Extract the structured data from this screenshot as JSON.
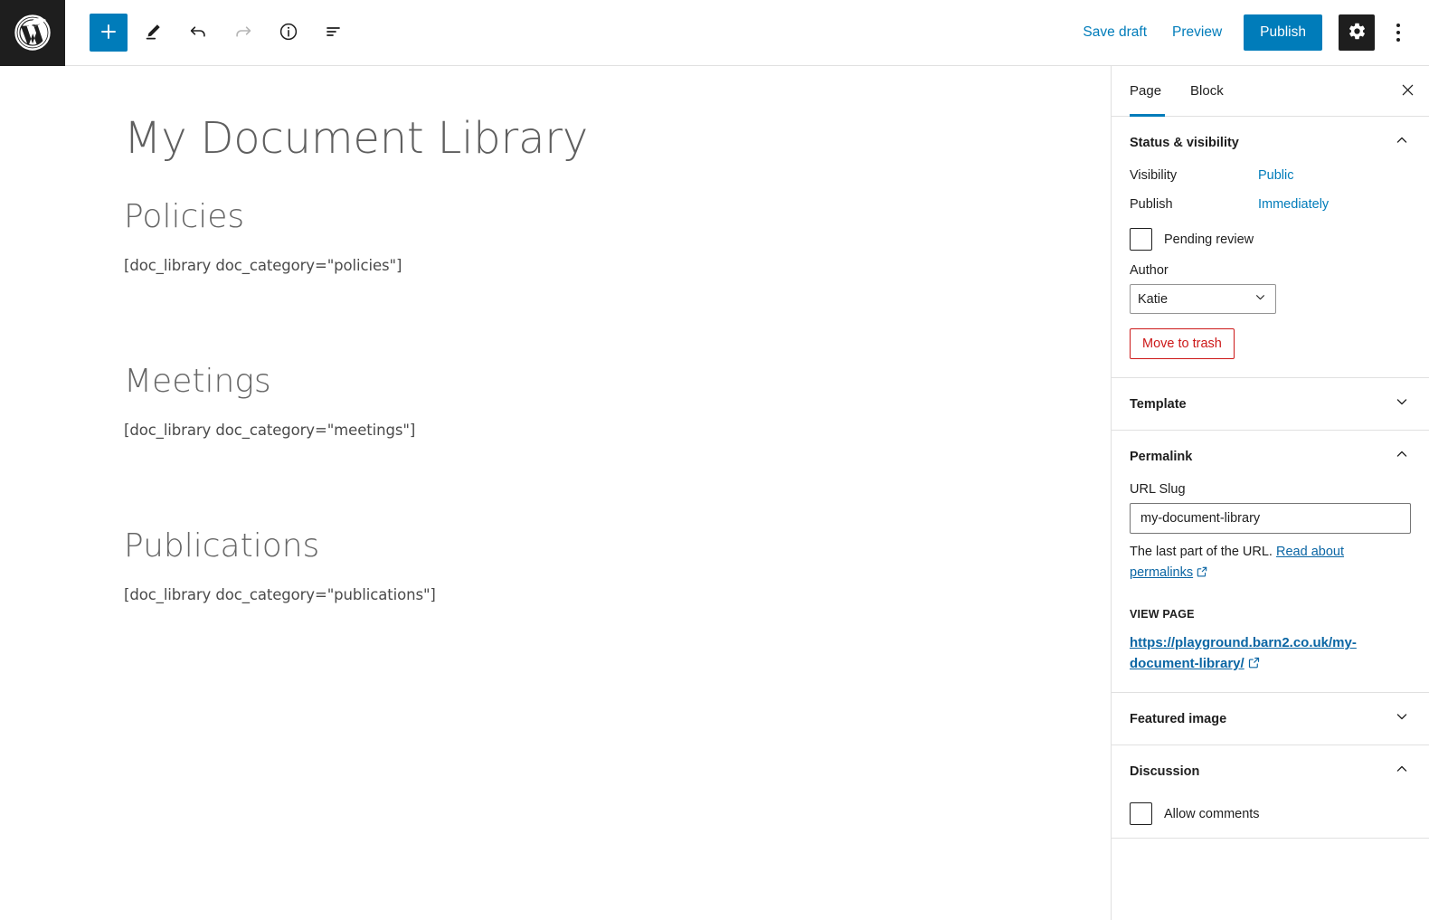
{
  "toolbar": {
    "logo_name": "WordPress",
    "left_tools": [
      {
        "name": "add-block-button",
        "icon": "plus-icon",
        "label": "Add block"
      },
      {
        "name": "edit-tool-button",
        "icon": "pencil-icon",
        "label": "Tools"
      },
      {
        "name": "undo-button",
        "icon": "undo-icon",
        "label": "Undo"
      },
      {
        "name": "redo-button",
        "icon": "redo-icon",
        "label": "Redo"
      },
      {
        "name": "details-button",
        "icon": "info-icon",
        "label": "Details"
      },
      {
        "name": "list-view-button",
        "icon": "list-view-icon",
        "label": "List View"
      }
    ],
    "save_draft_label": "Save draft",
    "preview_label": "Preview",
    "publish_label": "Publish",
    "settings_label": "Settings",
    "options_label": "Options"
  },
  "editor": {
    "title": "My Document Library",
    "sections": [
      {
        "heading": "Policies",
        "code": "[doc_library doc_category=\"policies\"]"
      },
      {
        "heading": "Meetings",
        "code": "[doc_library doc_category=\"meetings\"]"
      },
      {
        "heading": "Publications",
        "code": "[doc_library doc_category=\"publications\"]"
      }
    ]
  },
  "sidebar": {
    "tabs": [
      {
        "label": "Page",
        "active": true
      },
      {
        "label": "Block",
        "active": false
      }
    ],
    "close_label": "Close settings",
    "status_visibility": {
      "title": "Status & visibility",
      "visibility_label": "Visibility",
      "visibility_value": "Public",
      "publish_label": "Publish",
      "publish_value": "Immediately",
      "pending_review_label": "Pending review",
      "pending_review_checked": false,
      "author_label": "Author",
      "author_value": "Katie",
      "trash_label": "Move to trash"
    },
    "template": {
      "title": "Template"
    },
    "permalink": {
      "title": "Permalink",
      "slug_label": "URL Slug",
      "slug_value": "my-document-library",
      "slug_placeholder": "my-document-library",
      "help_text": "The last part of the URL.",
      "help_link": "Read about permalinks",
      "view_page_label": "VIEW PAGE",
      "view_page_url": "https://playground.barn2.co.uk/my-document-library/"
    },
    "featured_image": {
      "title": "Featured image"
    },
    "discussion": {
      "title": "Discussion",
      "allow_comments_label": "Allow comments",
      "allow_comments_checked": false
    }
  },
  "colors": {
    "accent": "#007cba",
    "link": "#0b66a4",
    "danger": "#cc1818",
    "dark": "#1e1e1e",
    "border": "#e0e0e0"
  }
}
